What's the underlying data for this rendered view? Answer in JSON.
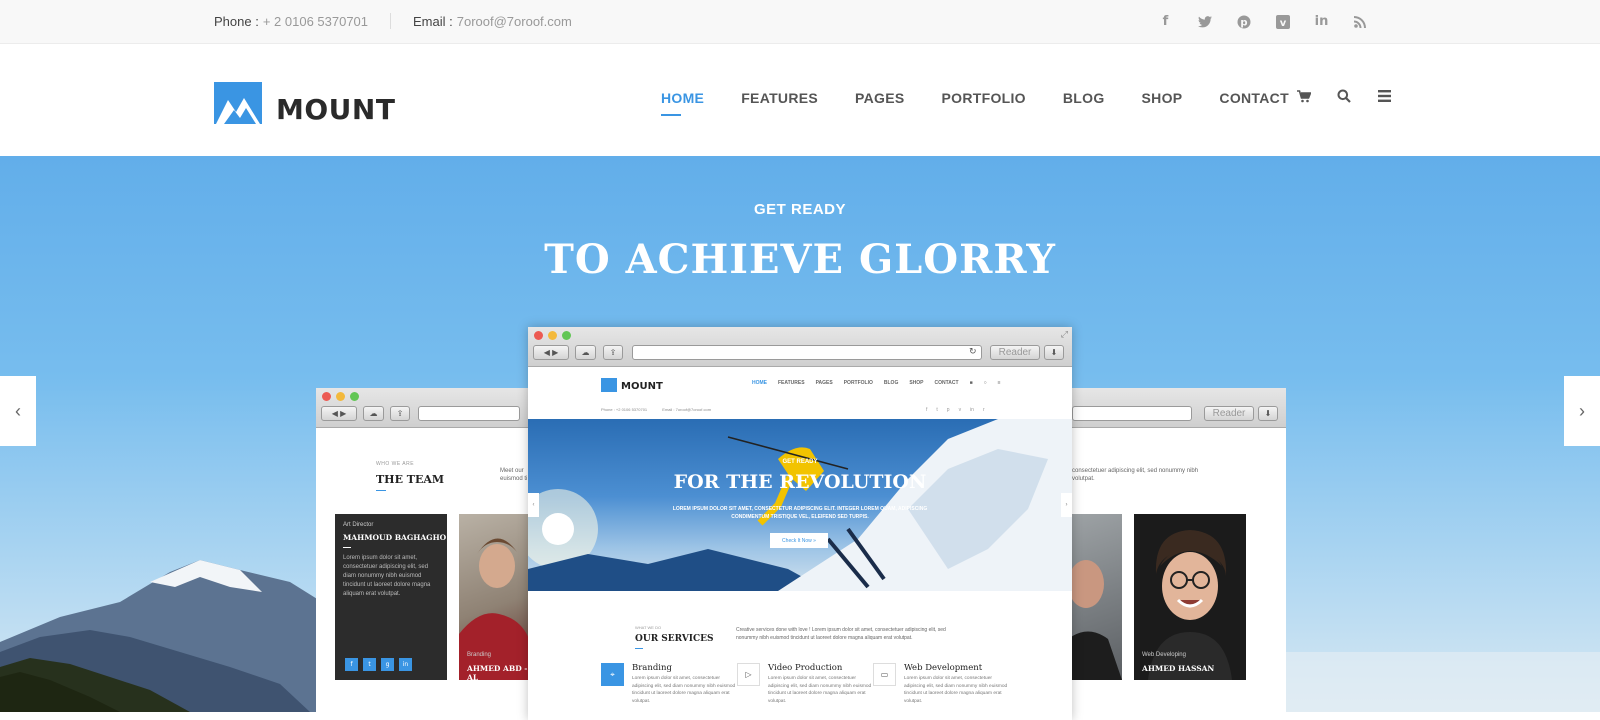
{
  "topbar": {
    "phone_label": "Phone :",
    "phone_value": "+ 2 0106 5370701",
    "email_label": "Email :",
    "email_value": "7oroof@7oroof.com",
    "social": [
      "facebook-icon",
      "twitter-icon",
      "pinterest-icon",
      "vimeo-icon",
      "linkedin-icon",
      "rss-icon"
    ]
  },
  "header": {
    "logo_text": "MOUNT",
    "nav": [
      "HOME",
      "FEATURES",
      "PAGES",
      "PORTFOLIO",
      "BLOG",
      "SHOP",
      "CONTACT"
    ],
    "active": "HOME",
    "accent": "#3a95e3"
  },
  "hero": {
    "kicker": "GET READY",
    "title": "TO ACHIEVE GLORRY",
    "prev": "‹",
    "next": "›"
  },
  "browser": {
    "reader": "Reader"
  },
  "team": {
    "kicker": "WHO WE ARE",
    "title": "THE TEAM",
    "intro_left": "Meet our",
    "intro_left2": "euismod ti",
    "intro_right": "consectetuer adipiscing elit, sed nonummy nibh",
    "intro_right2": "volutpat.",
    "members": [
      {
        "role": "Art Director",
        "name": "MAHMOUD BAGHAGHO",
        "bio": "Lorem ipsum dolor sit amet, consectetuer adipiscing elit, sed diam nonummy nibh euismod tincidunt ut laoreet dolore magna aliquam erat volutpat."
      },
      {
        "role": "Branding",
        "name": "AHMED ABD - AL"
      },
      {
        "role": "Web Developing",
        "name": "AHMED HASSAN"
      }
    ]
  },
  "mini": {
    "logo_text": "MOUNT",
    "nav": [
      "HOME",
      "FEATURES",
      "PAGES",
      "PORTFOLIO",
      "BLOG",
      "SHOP",
      "CONTACT"
    ],
    "phone": "Phone : +2 0106 5370701",
    "email": "Email : 7oroof@7oroof.com",
    "hero_kicker": "GET READY",
    "hero_title": "FOR THE REVOLUTION",
    "hero_text": "LOREM IPSUM DOLOR SIT AMET, CONSECTETUR ADIPISCING ELIT. INTEGER LOREM QUAM, ADIPISCING CONDIMENTUM TRISTIQUE VEL, ELEIFEND SED TURPIS.",
    "hero_button": "Check It Now »",
    "services_kicker": "WHAT WE DO",
    "services_title": "OUR SERVICES",
    "services_intro": "Creative services done with love ! Lorem ipsum dolor sit amet, consectetuer adipiscing elit, sed nonummy nibh euismod tincidunt ut laoreet dolore magna aliquam erat volutpat.",
    "services": [
      {
        "title": "Branding",
        "icon": "pin-icon",
        "text": "Lorem ipsum dolor sit amet, consectetuer adipiscing elit, sed diam nonummy nibh euismod tincidunt ut laoreet dolore magna aliquam erat volutpat."
      },
      {
        "title": "Video Production",
        "icon": "play-icon",
        "text": "Lorem ipsum dolor sit amet, consectetuer adipiscing elit, sed diam nonummy nibh euismod tincidunt ut laoreet dolore magna aliquam erat volutpat."
      },
      {
        "title": "Web Development",
        "icon": "monitor-icon",
        "text": "Lorem ipsum dolor sit amet, consectetuer adipiscing elit, sed diam nonummy nibh euismod tincidunt ut laoreet dolore magna aliquam erat volutpat."
      }
    ]
  }
}
